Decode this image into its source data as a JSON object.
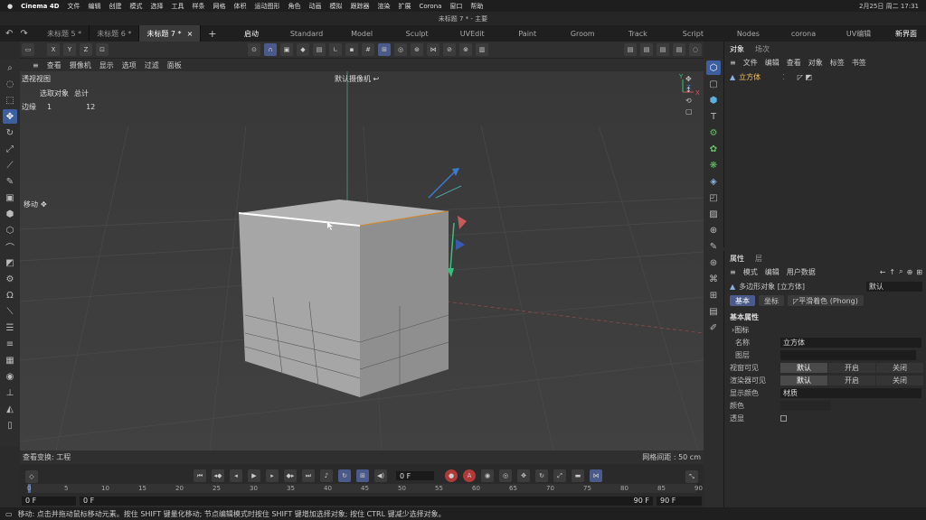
{
  "macmenu": {
    "app": "Cinema 4D",
    "items": [
      "文件",
      "编辑",
      "创建",
      "模式",
      "选择",
      "工具",
      "样条",
      "网格",
      "体积",
      "运动图形",
      "角色",
      "动画",
      "模拟",
      "跟踪器",
      "渲染",
      "扩展",
      "Corona",
      "窗口",
      "帮助"
    ],
    "clock": "2月25日 周二 17:31"
  },
  "titlebar": {
    "title": "未标题 7 * - 主要"
  },
  "doctabs": [
    {
      "label": "未标题 5 *"
    },
    {
      "label": "未标题 6 *"
    },
    {
      "label": "未标题 7 *"
    }
  ],
  "add_tab": "+",
  "layouts": [
    "启动",
    "Standard",
    "Model",
    "Sculpt",
    "UVEdit",
    "Paint",
    "Groom",
    "Track",
    "Script",
    "Nodes",
    "corona",
    "UV编辑"
  ],
  "new_layout": "新界面",
  "axis_labels": [
    "X",
    "Y",
    "Z"
  ],
  "viewport_menu": [
    "查看",
    "摄像机",
    "显示",
    "选项",
    "过滤",
    "面板"
  ],
  "viewport": {
    "view_name": "透视视图",
    "camera": "默认摄像机",
    "stats_header": [
      "选取对象",
      "总计"
    ],
    "stats_row": {
      "label": "边缘",
      "selected": "1",
      "total": "12"
    },
    "tool_label": "移动",
    "footer_left": "查看变换: 工程",
    "footer_right": "网格间距 : 50 cm",
    "colors": {
      "bg": "#3c3c3c",
      "cube_front": "#a6a6a6",
      "cube_side": "#8f8f8f",
      "cube_top": "#b3b3b3",
      "selected_edge": "#ffffff"
    }
  },
  "timeline": {
    "frame_current": "0 F",
    "ticks": [
      "0",
      "5",
      "10",
      "15",
      "20",
      "25",
      "30",
      "35",
      "40",
      "45",
      "50",
      "55",
      "60",
      "65",
      "70",
      "75",
      "80",
      "85",
      "90"
    ],
    "start": "0 F",
    "start2": "0 F",
    "end": "90 F",
    "end2": "90 F"
  },
  "status": "移动: 点击并拖动鼠标移动元素。按住 SHIFT 键量化移动; 节点编辑模式时按住 SHIFT 键增加选择对象; 按住 CTRL 键减少选择对象。",
  "objects_panel": {
    "tabs": [
      "对象",
      "场次"
    ],
    "menu": [
      "文件",
      "编辑",
      "查看",
      "对象",
      "标签",
      "书签"
    ],
    "items": [
      {
        "name": "立方体"
      }
    ]
  },
  "attr_panel": {
    "tabs": [
      "属性",
      "层"
    ],
    "menu": [
      "模式",
      "编辑",
      "用户数据"
    ],
    "object_title": "多边形对象 [立方体]",
    "preset": "默认",
    "subtabs": [
      "基本",
      "坐标",
      "平滑着色 (Phong)"
    ],
    "section": "基本属性",
    "icon_row": "图标",
    "name_label": "名称",
    "name_value": "立方体",
    "layer_label": "图层",
    "editor_label": "视窗可见",
    "render_label": "渲染器可见",
    "visibility_options": [
      "默认",
      "开启",
      "关闭"
    ],
    "display_color_label": "显示颜色",
    "display_color_value": "材质",
    "color_label": "颜色",
    "xray_label": "透显"
  },
  "accent": "#4a5a8a"
}
